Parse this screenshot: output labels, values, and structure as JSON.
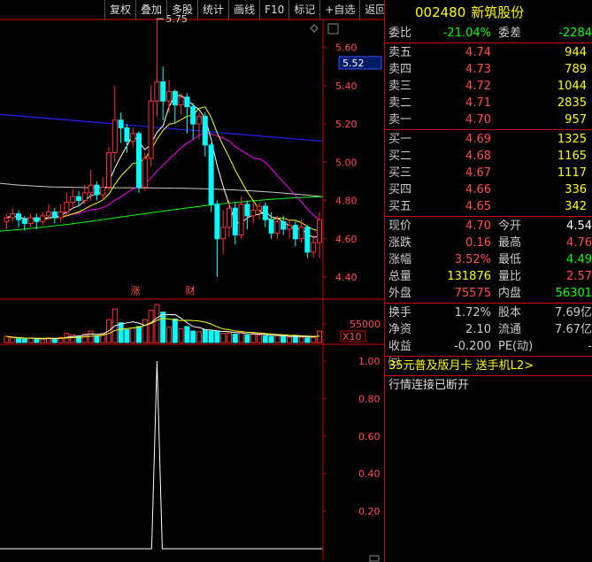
{
  "toolbar": [
    "复权",
    "叠加",
    "多股",
    "统计",
    "画线",
    "F10",
    "标记",
    "+自选",
    "返回"
  ],
  "stock": {
    "code": "002480",
    "name": "新筑股份"
  },
  "main_chart": {
    "y_ticks": [
      "5.60",
      "5.40",
      "5.20",
      "5.00",
      "4.80",
      "4.60",
      "4.40"
    ],
    "y_min": 4.34,
    "y_max": 5.7,
    "current_price_label": "5.52",
    "high_marker": "5.75",
    "events": [
      "涨",
      "财"
    ],
    "colors": {
      "up": "#ff3333",
      "down": "#00ffff",
      "ma5": "#ffffff",
      "ma10": "#ffff00",
      "ma20": "#ff00ff",
      "ma60": "#00ff00",
      "ma120": "#cccccc",
      "ma250": "#2222ff"
    }
  },
  "volume_chart": {
    "tick_label": "55000",
    "multiplier": "X10"
  },
  "indicator": {
    "y_ticks": [
      "1.00",
      "0.80",
      "0.60",
      "0.40",
      "0.20"
    ],
    "spike_value": 1.0
  },
  "chart_data": {
    "type": "candlestick",
    "candles": [
      [
        4.69,
        4.71,
        4.65,
        4.73
      ],
      [
        4.71,
        4.73,
        4.69,
        4.76
      ],
      [
        4.73,
        4.7,
        4.66,
        4.75
      ],
      [
        4.7,
        4.68,
        4.64,
        4.72
      ],
      [
        4.68,
        4.71,
        4.66,
        4.73
      ],
      [
        4.71,
        4.69,
        4.65,
        4.73
      ],
      [
        4.69,
        4.72,
        4.67,
        4.74
      ],
      [
        4.72,
        4.74,
        4.7,
        4.78
      ],
      [
        4.74,
        4.71,
        4.68,
        4.76
      ],
      [
        4.71,
        4.74,
        4.69,
        4.78
      ],
      [
        4.74,
        4.79,
        4.72,
        4.84
      ],
      [
        4.79,
        4.82,
        4.76,
        4.86
      ],
      [
        4.82,
        4.8,
        4.77,
        4.85
      ],
      [
        4.8,
        4.84,
        4.78,
        4.88
      ],
      [
        4.84,
        4.88,
        4.8,
        4.96
      ],
      [
        4.88,
        4.83,
        4.8,
        4.9
      ],
      [
        4.83,
        4.87,
        4.8,
        4.92
      ],
      [
        4.87,
        5.05,
        4.85,
        5.08
      ],
      [
        5.05,
        5.22,
        5.0,
        5.4
      ],
      [
        5.22,
        5.18,
        5.1,
        5.26
      ],
      [
        5.18,
        5.11,
        5.05,
        5.2
      ],
      [
        5.11,
        5.15,
        5.08,
        5.18
      ],
      [
        5.15,
        4.87,
        4.84,
        5.16
      ],
      [
        4.87,
        5.02,
        4.85,
        5.05
      ],
      [
        5.02,
        5.32,
        4.98,
        5.4
      ],
      [
        5.32,
        5.42,
        5.24,
        5.75
      ],
      [
        5.42,
        5.32,
        5.22,
        5.5
      ],
      [
        5.32,
        5.37,
        5.26,
        5.43
      ],
      [
        5.37,
        5.3,
        5.2,
        5.38
      ],
      [
        5.3,
        5.34,
        5.25,
        5.36
      ],
      [
        5.34,
        5.29,
        5.15,
        5.36
      ],
      [
        5.29,
        5.2,
        5.12,
        5.31
      ],
      [
        5.2,
        5.24,
        5.12,
        5.26
      ],
      [
        5.24,
        5.09,
        5.03,
        5.26
      ],
      [
        5.09,
        4.78,
        4.74,
        5.1
      ],
      [
        4.78,
        4.6,
        4.4,
        4.8
      ],
      [
        4.6,
        4.66,
        4.52,
        4.75
      ],
      [
        4.66,
        4.76,
        4.61,
        4.8
      ],
      [
        4.76,
        4.62,
        4.57,
        4.79
      ],
      [
        4.62,
        4.78,
        4.6,
        4.82
      ],
      [
        4.78,
        4.72,
        4.65,
        4.8
      ],
      [
        4.72,
        4.75,
        4.68,
        4.79
      ],
      [
        4.75,
        4.77,
        4.7,
        4.79
      ],
      [
        4.77,
        4.7,
        4.66,
        4.79
      ],
      [
        4.7,
        4.63,
        4.6,
        4.74
      ],
      [
        4.63,
        4.69,
        4.6,
        4.72
      ],
      [
        4.69,
        4.65,
        4.62,
        4.72
      ],
      [
        4.65,
        4.67,
        4.6,
        4.7
      ],
      [
        4.67,
        4.6,
        4.56,
        4.69
      ],
      [
        4.6,
        4.66,
        4.58,
        4.7
      ],
      [
        4.66,
        4.53,
        4.5,
        4.67
      ],
      [
        4.53,
        4.58,
        4.5,
        4.62
      ],
      [
        4.58,
        4.7,
        4.5,
        4.74
      ]
    ],
    "volumes": [
      16,
      12,
      10,
      9,
      11,
      10,
      9,
      12,
      10,
      13,
      24,
      20,
      17,
      22,
      30,
      18,
      24,
      60,
      88,
      52,
      34,
      38,
      42,
      60,
      85,
      100,
      80,
      40,
      62,
      36,
      42,
      30,
      28,
      34,
      30,
      30,
      24,
      25,
      22,
      26,
      20,
      22,
      20,
      18,
      16,
      18,
      16,
      14,
      18,
      14,
      12,
      14,
      30
    ],
    "indicator_values": "all 0 except candle 25 which is 1.0"
  },
  "quote": {
    "webi": {
      "label": "委比",
      "value": "-21.04%",
      "label2": "委差",
      "value2": "-2284"
    },
    "asks": [
      {
        "label": "卖五",
        "price": "4.74",
        "vol": "944"
      },
      {
        "label": "卖四",
        "price": "4.73",
        "vol": "789"
      },
      {
        "label": "卖三",
        "price": "4.72",
        "vol": "1044"
      },
      {
        "label": "卖二",
        "price": "4.71",
        "vol": "2835"
      },
      {
        "label": "卖一",
        "price": "4.70",
        "vol": "957"
      }
    ],
    "bids": [
      {
        "label": "买一",
        "price": "4.69",
        "vol": "1325"
      },
      {
        "label": "买二",
        "price": "4.68",
        "vol": "1165"
      },
      {
        "label": "买三",
        "price": "4.67",
        "vol": "1117"
      },
      {
        "label": "买四",
        "price": "4.66",
        "vol": "336"
      },
      {
        "label": "买五",
        "price": "4.65",
        "vol": "342"
      }
    ],
    "stats": [
      {
        "l1": "现价",
        "v1": "4.70",
        "c1": "red",
        "l2": "今开",
        "v2": "4.54",
        "c2": "wht"
      },
      {
        "l1": "涨跌",
        "v1": "0.16",
        "c1": "red",
        "l2": "最高",
        "v2": "4.76",
        "c2": "red"
      },
      {
        "l1": "涨幅",
        "v1": "3.52%",
        "c1": "red",
        "l2": "最低",
        "v2": "4.49",
        "c2": "grn"
      },
      {
        "l1": "总量",
        "v1": "131876",
        "c1": "yel",
        "l2": "量比",
        "v2": "2.57",
        "c2": "red"
      },
      {
        "l1": "外盘",
        "v1": "75575",
        "c1": "red",
        "l2": "内盘",
        "v2": "56301",
        "c2": "grn"
      }
    ],
    "stats2": [
      {
        "l1": "换手",
        "v1": "1.72%",
        "c1": "grey",
        "l2": "股本",
        "v2": "7.69亿",
        "c2": "grey"
      },
      {
        "l1": "净资",
        "v1": "2.10",
        "c1": "grey",
        "l2": "流通",
        "v2": "7.67亿",
        "c2": "grey"
      },
      {
        "l1": "收益㈢",
        "v1": "-0.200",
        "c1": "grey",
        "l2": "PE(动)",
        "v2": "-",
        "c2": "grey"
      }
    ],
    "promo": "35元普及版月卡 送手机L2>",
    "status": "行情连接已断开"
  }
}
